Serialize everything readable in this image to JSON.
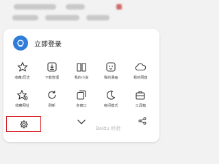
{
  "login": {
    "label": "立即登录"
  },
  "grid": {
    "row1": [
      {
        "label": "收藏/历史",
        "icon": "star-icon"
      },
      {
        "label": "下载管理",
        "icon": "download-icon"
      },
      {
        "label": "我的小说",
        "icon": "book-icon"
      },
      {
        "label": "我的漫画",
        "icon": "comic-icon"
      },
      {
        "label": "我的网盘",
        "icon": "cloud-icon"
      }
    ],
    "row2": [
      {
        "label": "收藏网址",
        "icon": "add-bookmark-icon"
      },
      {
        "label": "刷新",
        "icon": "refresh-icon"
      },
      {
        "label": "多窗口",
        "icon": "multi-window-icon"
      },
      {
        "label": "夜间模式",
        "icon": "moon-icon"
      },
      {
        "label": "工具箱",
        "icon": "toolbox-icon"
      }
    ]
  },
  "bottom": {
    "settings_icon": "gear-icon",
    "collapse_icon": "chevron-down-icon",
    "share_icon": "share-icon"
  },
  "watermark": {
    "text": "Baidu 经验"
  },
  "colors": {
    "accent": "#2f7dd9",
    "highlight": "#d7262b",
    "panel": "#ffffff",
    "background": "#f2f2f2"
  }
}
